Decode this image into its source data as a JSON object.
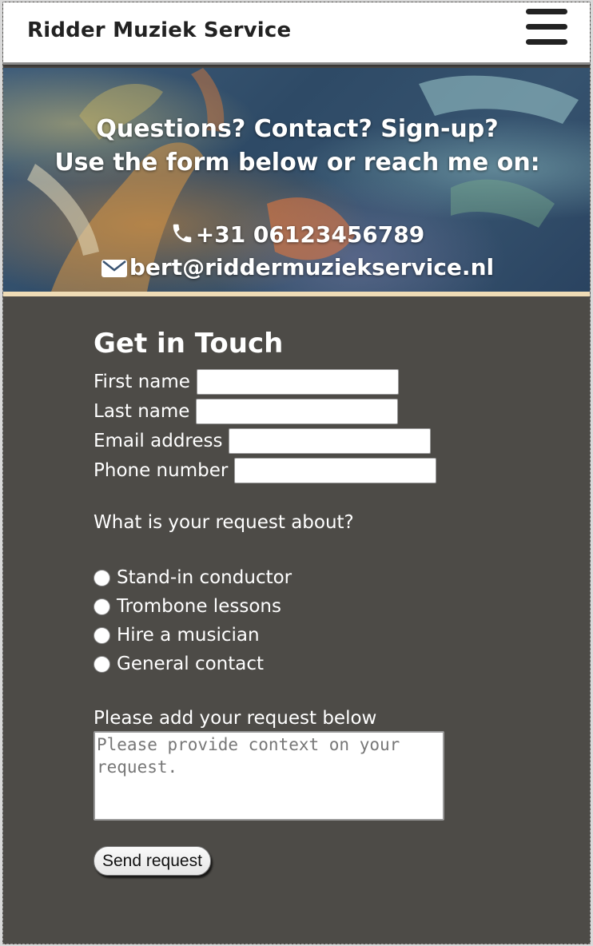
{
  "header": {
    "site_title": "Ridder Muziek Service",
    "menu_icon": "hamburger-menu-icon"
  },
  "hero": {
    "line1": "Questions? Contact? Sign-up?",
    "line2": "Use the form below or reach me on:",
    "phone": "+31 06123456789",
    "phone_icon": "phone-icon",
    "email": "bert@riddermuziekservice.nl",
    "email_icon": "envelope-icon"
  },
  "form": {
    "title": "Get in Touch",
    "fields": [
      {
        "label": "First name",
        "value": ""
      },
      {
        "label": "Last name",
        "value": ""
      },
      {
        "label": "Email address",
        "value": ""
      },
      {
        "label": "Phone number",
        "value": ""
      }
    ],
    "question": "What is your request about?",
    "options": [
      "Stand-in conductor",
      "Trombone lessons",
      "Hire a musician",
      "General contact"
    ],
    "request_label": "Please add your request below",
    "request_placeholder": "Please provide context on your request.",
    "send_label": "Send request"
  },
  "colors": {
    "form_background": "#4d4b47",
    "header_background": "#ffffff",
    "hero_accent_border": "#efdcb6"
  }
}
